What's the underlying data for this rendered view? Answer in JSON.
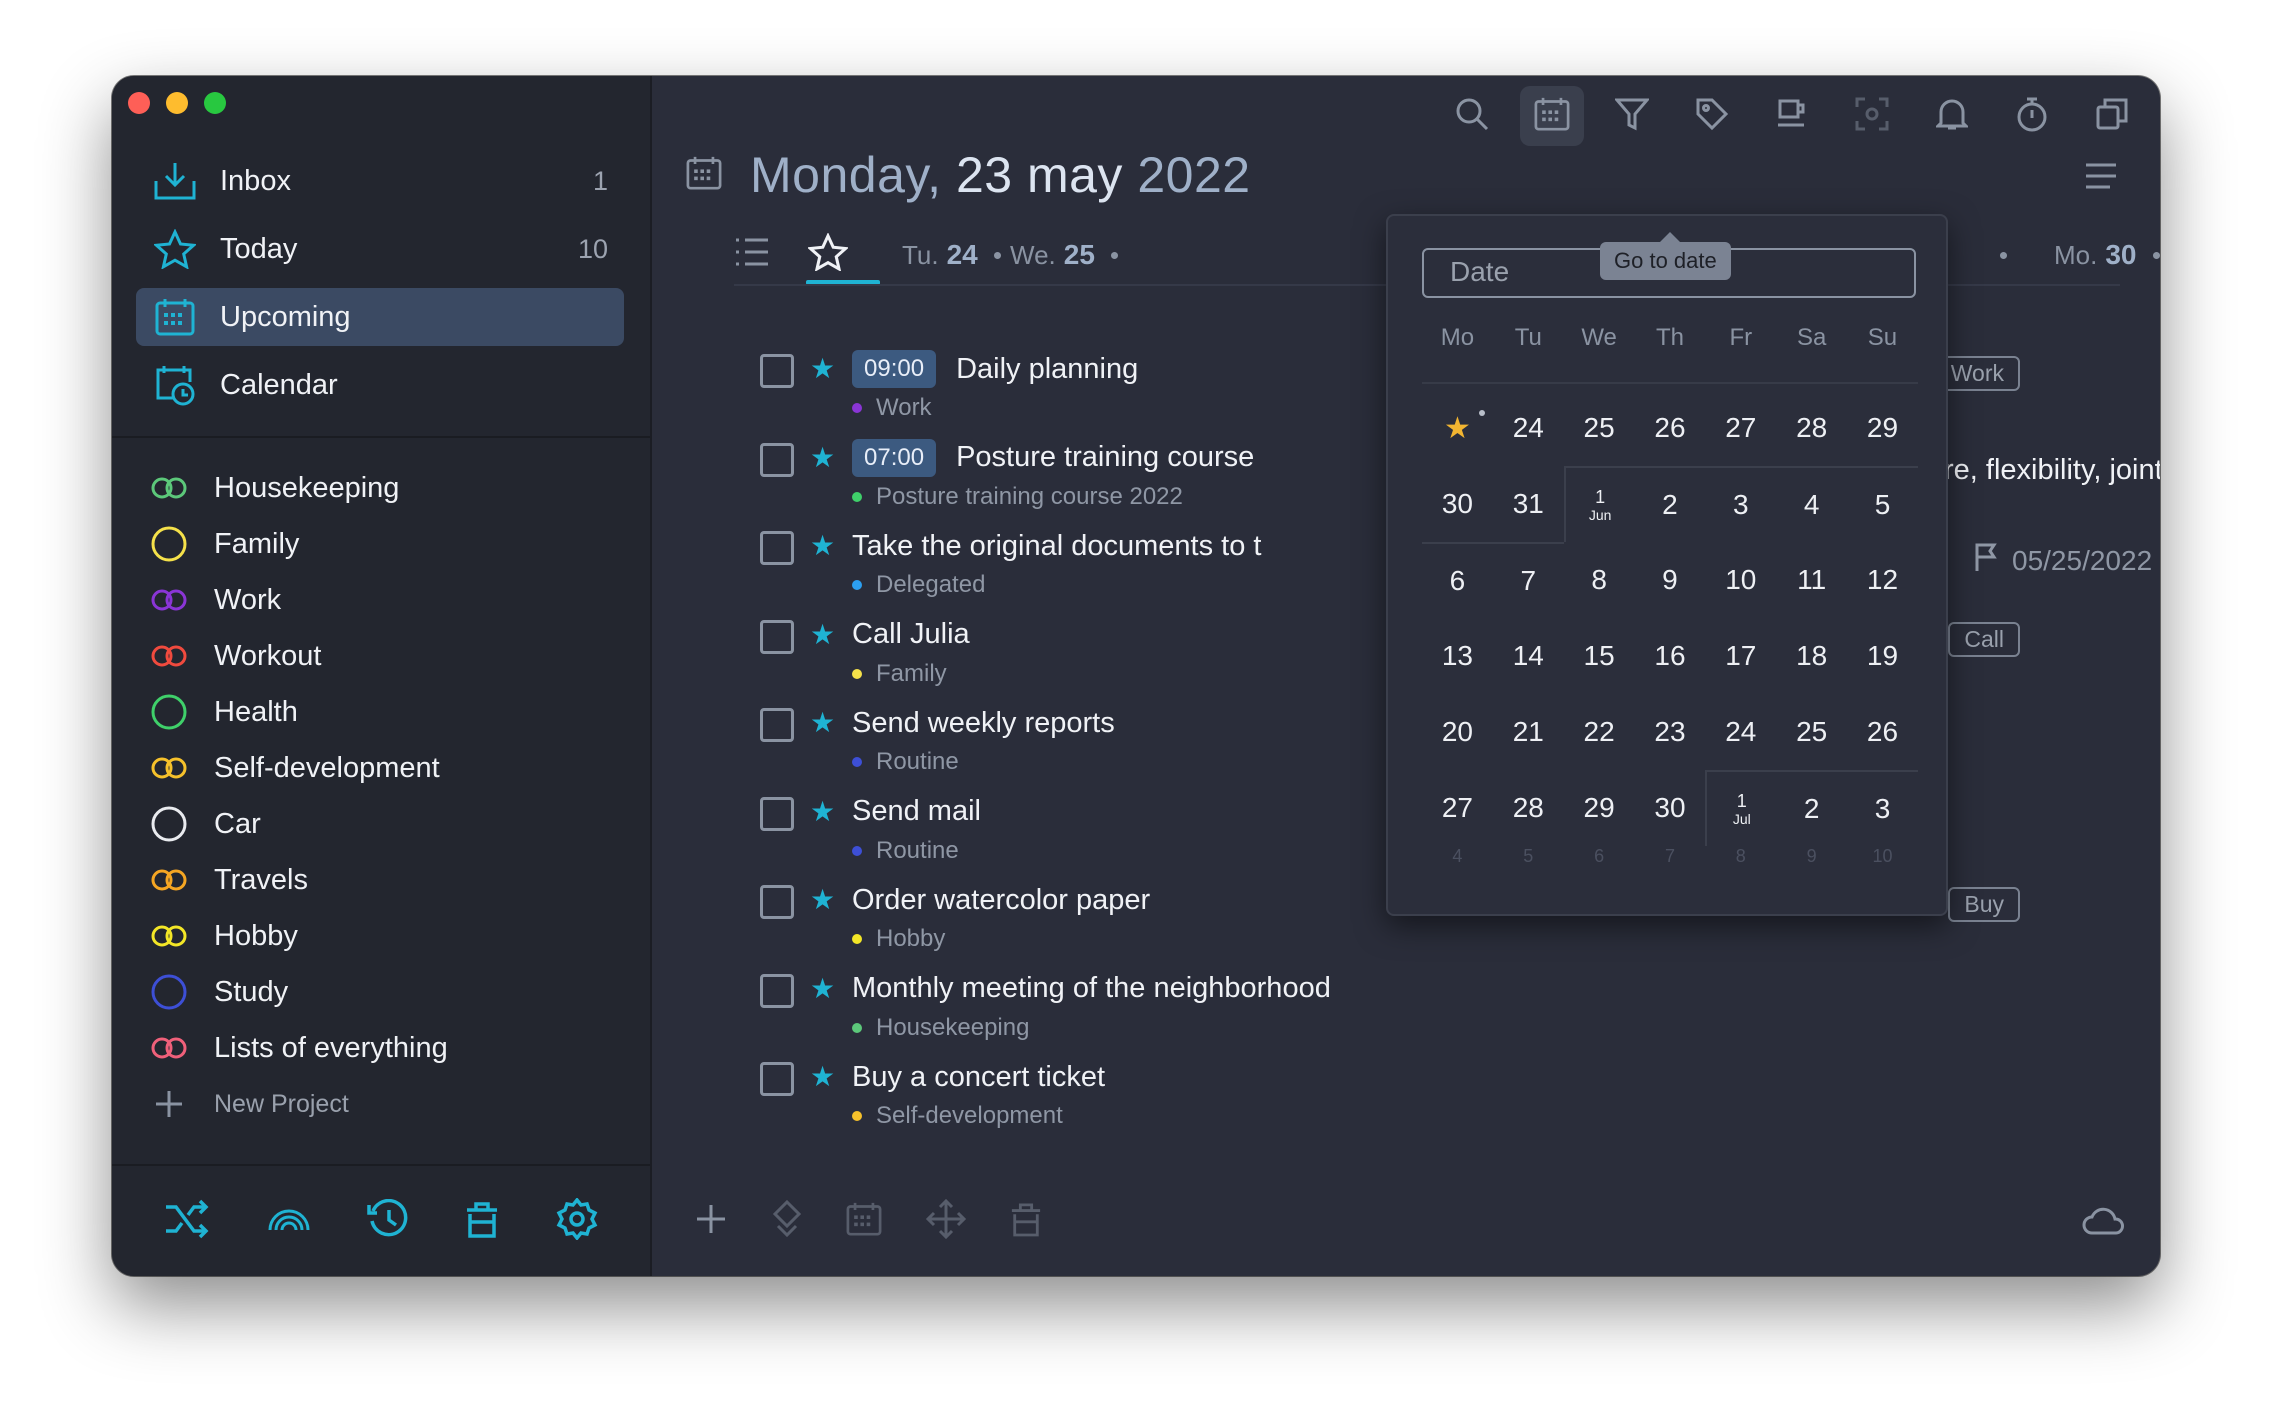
{
  "sidebar": {
    "smart_lists": [
      {
        "label": "Inbox",
        "count": "1"
      },
      {
        "label": "Today",
        "count": "10"
      },
      {
        "label": "Upcoming",
        "count": ""
      },
      {
        "label": "Calendar",
        "count": ""
      }
    ],
    "projects": [
      {
        "label": "Housekeeping",
        "color": "#5cc87a"
      },
      {
        "label": "Family",
        "color": "#f5e14a"
      },
      {
        "label": "Work",
        "color": "#8a35d6"
      },
      {
        "label": "Workout",
        "color": "#f04a3e"
      },
      {
        "label": "Health",
        "color": "#3fd06a"
      },
      {
        "label": "Self-development",
        "color": "#f6c12b"
      },
      {
        "label": "Car",
        "color": "#e9ebef"
      },
      {
        "label": "Travels",
        "color": "#f5a623"
      },
      {
        "label": "Hobby",
        "color": "#f3e627"
      },
      {
        "label": "Study",
        "color": "#3d4fd6"
      },
      {
        "label": "Lists of everything",
        "color": "#f0607a"
      }
    ],
    "new_project": "New Project"
  },
  "header": {
    "weekday": "Monday,",
    "day_month": "23 may",
    "year": "2022"
  },
  "tabs": [
    {
      "prefix": "Tu.",
      "day": "24"
    },
    {
      "prefix": "We.",
      "day": "25"
    },
    {
      "prefix": "Mo.",
      "day": "30"
    }
  ],
  "tasks": [
    {
      "time": "09:00",
      "title": "Daily planning",
      "project": "Work",
      "project_color": "#8a35d6",
      "tag": "Work"
    },
    {
      "time": "07:00",
      "title": "Posture training course",
      "project": "Posture training course 2022",
      "project_color": "#3fd06a",
      "tag": ""
    },
    {
      "time": "",
      "title": "Take the original documents to t",
      "project": "Delegated",
      "project_color": "#2c9ff0",
      "tag": ""
    },
    {
      "time": "",
      "title": "Call Julia",
      "project": "Family",
      "project_color": "#f5e14a",
      "tag": "Call"
    },
    {
      "time": "",
      "title": "Send weekly reports",
      "project": "Routine",
      "project_color": "#3d4fd6",
      "tag": ""
    },
    {
      "time": "",
      "title": "Send mail",
      "project": "Routine",
      "project_color": "#3d4fd6",
      "tag": ""
    },
    {
      "time": "",
      "title": "Order watercolor paper",
      "project": "Hobby",
      "project_color": "#f3e627",
      "tag": "Buy"
    },
    {
      "time": "",
      "title": "Monthly meeting of the neighborhood",
      "project": "Housekeeping",
      "project_color": "#5cc87a",
      "tag": ""
    },
    {
      "time": "",
      "title": "Buy a concert ticket",
      "project": "Self-development",
      "project_color": "#f6c12b",
      "tag": ""
    }
  ],
  "right_snippet": "re, flexibility, joint",
  "due_date": "05/25/2022",
  "datepicker": {
    "placeholder": "Date",
    "tooltip": "Go to date",
    "weekdays": [
      "Mo",
      "Tu",
      "We",
      "Th",
      "Fr",
      "Sa",
      "Su"
    ],
    "weeks": [
      [
        "★",
        "24",
        "25",
        "26",
        "27",
        "28",
        "29"
      ],
      [
        "30",
        "31",
        "1|Jun",
        "2",
        "3",
        "4",
        "5"
      ],
      [
        "6",
        "7",
        "8",
        "9",
        "10",
        "11",
        "12"
      ],
      [
        "13",
        "14",
        "15",
        "16",
        "17",
        "18",
        "19"
      ],
      [
        "20",
        "21",
        "22",
        "23",
        "24",
        "25",
        "26"
      ],
      [
        "27",
        "28",
        "29",
        "30",
        "1|Jul",
        "2",
        "3"
      ]
    ],
    "faded_row": [
      "4",
      "5",
      "6",
      "7",
      "8",
      "9",
      "10"
    ]
  },
  "accent": "#1fb3d3"
}
